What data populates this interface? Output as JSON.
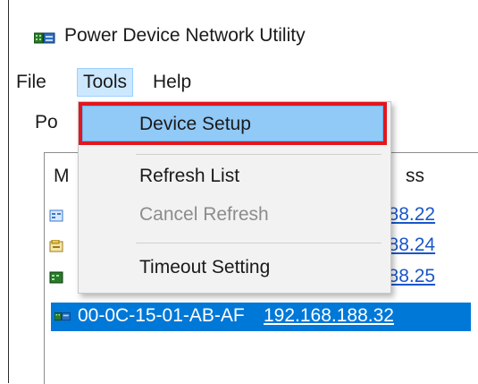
{
  "window": {
    "title": "Power Device Network Utility",
    "icon": "network-device-icon"
  },
  "menubar": {
    "items": [
      {
        "label": "File"
      },
      {
        "label": "Tools"
      },
      {
        "label": "Help"
      }
    ]
  },
  "group_label": "Po",
  "list": {
    "col_mac_header": "M",
    "col_ip_header": "ss",
    "rows": [
      {
        "mac": "",
        "ip": ".188.22",
        "icon": "device-icon"
      },
      {
        "mac": "",
        "ip": ".188.24",
        "icon": "device-icon"
      },
      {
        "mac": "",
        "ip": ".188.25",
        "icon": "device-icon"
      },
      {
        "mac": "00-0C-15-01-AB-AF",
        "ip": "192.168.188.32",
        "icon": "device-icon",
        "selected": true
      }
    ]
  },
  "tools_menu": {
    "items": [
      {
        "label": "Device Setup",
        "highlighted": true
      },
      {
        "label": "Refresh List"
      },
      {
        "label": "Cancel Refresh",
        "disabled": true
      },
      {
        "label": "Timeout Setting"
      }
    ]
  },
  "colors": {
    "selection": "#0078d7",
    "menu_highlight": "#91c9f7",
    "annotation_box": "#e1171e",
    "link": "#1a56c9"
  }
}
